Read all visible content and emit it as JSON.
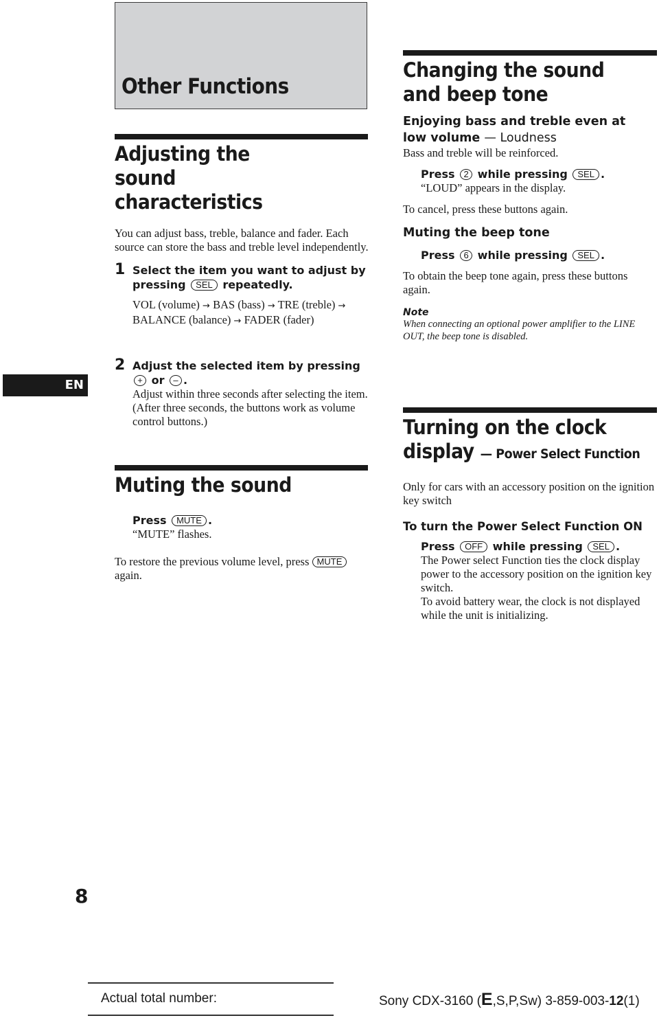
{
  "page": {
    "section_title": "Other Functions",
    "language_tab": "EN",
    "page_number": "8"
  },
  "adjusting": {
    "heading": "Adjusting the sound characteristics",
    "intro": "You can adjust bass, treble, balance and fader. Each source can store the bass and treble level independently.",
    "step1": {
      "number": "1",
      "text_before": "Select the item you want to adjust by pressing",
      "key": "SEL",
      "text_after": "repeatedly.",
      "sequence": [
        "VOL (volume)",
        "BAS (bass)",
        "TRE (treble)",
        "BALANCE (balance)",
        "FADER (fader)"
      ],
      "arrow": "→"
    },
    "step2": {
      "number": "2",
      "text_before": "Adjust the selected item by pressing",
      "key_plus": "+",
      "text_mid": "or",
      "key_minus": "–",
      "text_after": ".",
      "detail": "Adjust within three seconds after selecting the item. (After three seconds, the buttons work as volume control buttons.)"
    }
  },
  "muting": {
    "heading": "Muting the sound",
    "press_label": "Press",
    "key": "MUTE",
    "result": "“MUTE” flashes.",
    "restore_text": "To restore the previous volume level, press",
    "restore_after": "again."
  },
  "changing": {
    "heading": "Changing the sound and beep tone",
    "loudness": {
      "subheading": "Enjoying bass and treble even at low volume",
      "subheading_suffix": "— Loudness",
      "intro": "Bass and treble will be reinforced.",
      "press_label": "Press",
      "key1": "2",
      "while_label": "while pressing",
      "key2": "SEL",
      "result": "“LOUD” appears in the display.",
      "cancel": "To cancel, press these buttons again."
    },
    "beep": {
      "subheading": "Muting the beep tone",
      "press_label": "Press",
      "key1": "6",
      "while_label": "while pressing",
      "key2": "SEL",
      "restore": "To obtain the beep tone again, press these buttons again.",
      "note_label": "Note",
      "note_text": "When connecting an optional power amplifier to the LINE OUT, the beep tone is disabled."
    }
  },
  "clock": {
    "heading": "Turning on the clock display",
    "heading_suffix": "— Power Select Function",
    "intro": "Only for cars with an accessory position on the ignition key switch",
    "subheading": "To turn the Power Select Function ON",
    "press_label": "Press",
    "key1": "OFF",
    "while_label": "while pressing",
    "key2": "SEL",
    "detail1": "The Power select Function ties the clock display power to the accessory position on the ignition key switch.",
    "detail2": "To avoid battery wear, the clock is not displayed while the unit is initializing."
  },
  "footer": {
    "actual_total_label": "Actual total number:",
    "model_prefix": "Sony CDX-3160 (",
    "model_lang_bold": "E",
    "model_lang_rest": ",S,P,Sw)  3-859-003-",
    "model_rev_bold": "12",
    "model_rev_rest": "(1)"
  }
}
